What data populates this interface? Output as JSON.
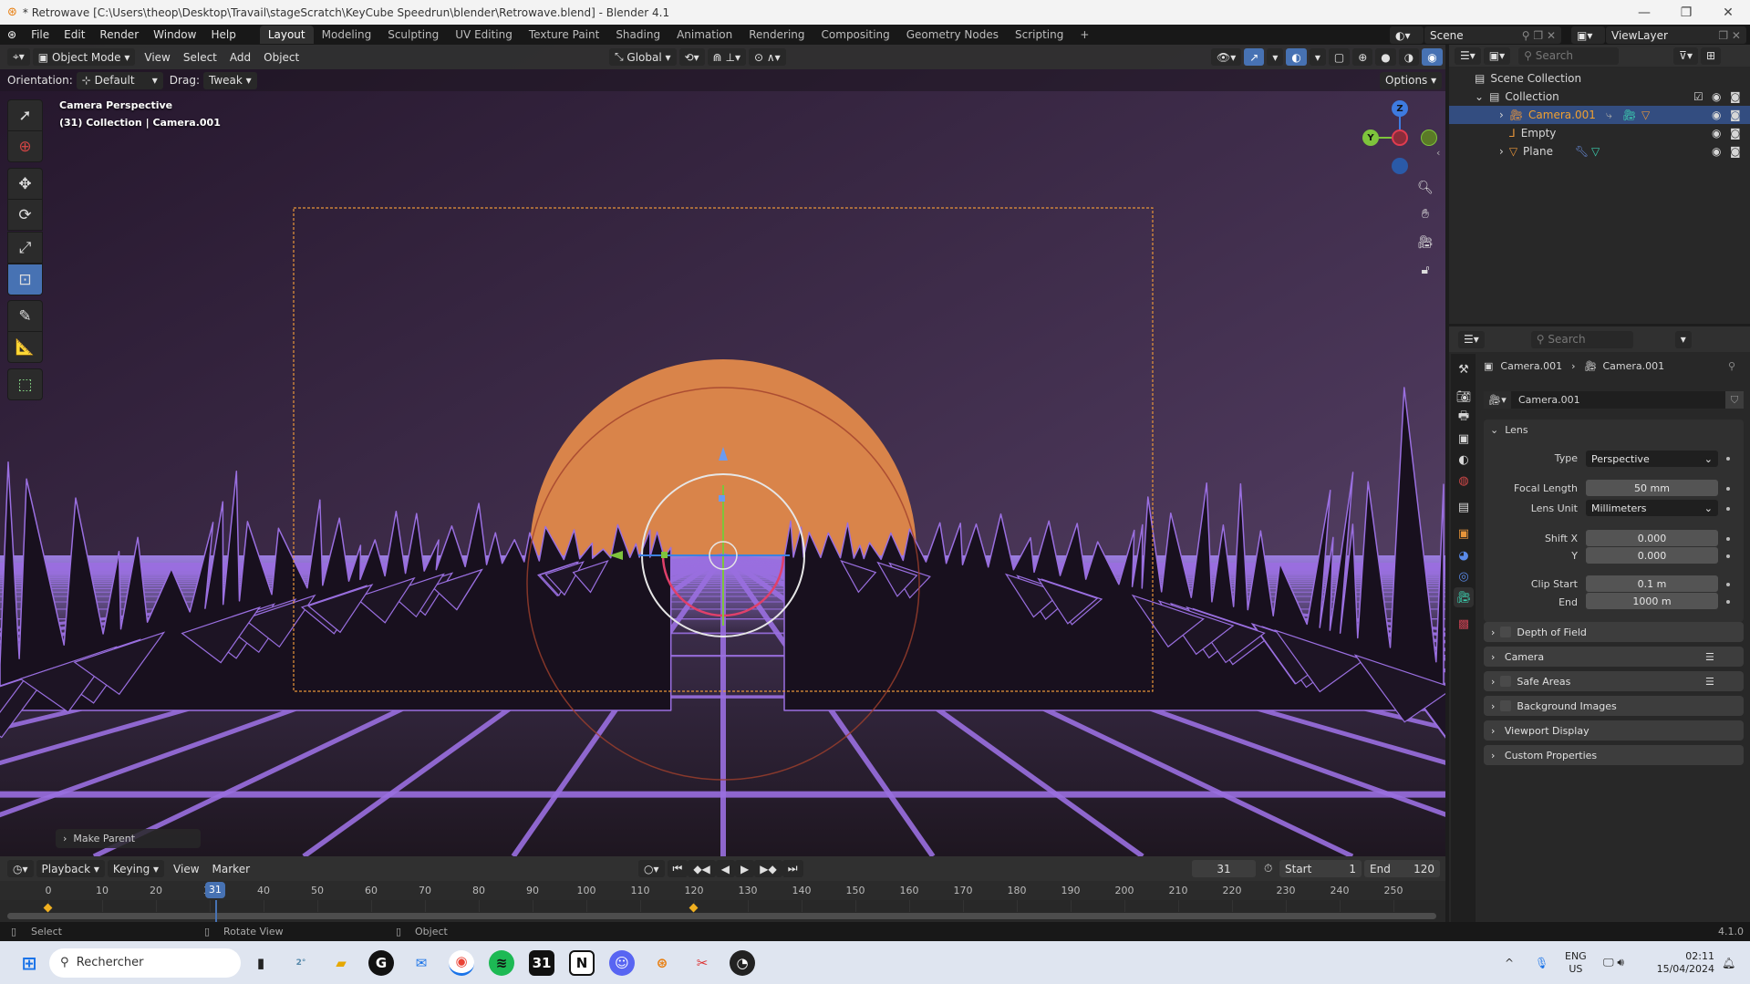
{
  "window": {
    "title": "* Retrowave [C:\\Users\\theop\\Desktop\\Travail\\stageScratch\\KeyCube Speedrun\\blender\\Retrowave.blend] - Blender 4.1"
  },
  "menu": {
    "items": [
      "File",
      "Edit",
      "Render",
      "Window",
      "Help"
    ],
    "workspaces": [
      "Layout",
      "Modeling",
      "Sculpting",
      "UV Editing",
      "Texture Paint",
      "Shading",
      "Animation",
      "Rendering",
      "Compositing",
      "Geometry Nodes",
      "Scripting"
    ],
    "active_workspace": "Layout",
    "add_tab": "+",
    "scene": "Scene",
    "view_layer": "ViewLayer"
  },
  "viewport": {
    "mode": "Object Mode",
    "menus": [
      "View",
      "Select",
      "Add",
      "Object"
    ],
    "transform_orientation": "Global",
    "orientation_label": "Orientation:",
    "orientation_value": "Default",
    "drag_label": "Drag:",
    "drag_value": "Tweak",
    "options": "Options",
    "overlay_line1": "Camera Perspective",
    "overlay_line2": "(31) Collection | Camera.001",
    "last_operator": "Make Parent",
    "gizmo": {
      "z": "Z",
      "y": "Y"
    },
    "colors": {
      "sun": "#d9844a",
      "grid": "#9a6fe0",
      "sky_top": "#2a1a30",
      "camera_frame": "#e8953a",
      "active_tool": "#4772b3"
    }
  },
  "outliner": {
    "search_placeholder": "Search",
    "rows": [
      {
        "label": "Scene Collection"
      },
      {
        "label": "Collection"
      },
      {
        "label": "Camera.001",
        "selected": true
      },
      {
        "label": "Empty"
      },
      {
        "label": "Plane"
      }
    ]
  },
  "properties": {
    "search_placeholder": "Search",
    "breadcrumb": [
      "Camera.001",
      "Camera.001"
    ],
    "datablock": "Camera.001",
    "lens": {
      "title": "Lens",
      "type_label": "Type",
      "type": "Perspective",
      "focal_label": "Focal Length",
      "focal": "50 mm",
      "unit_label": "Lens Unit",
      "unit": "Millimeters",
      "shiftx_label": "Shift X",
      "shiftx": "0.000",
      "shifty_label": "Y",
      "shifty": "0.000",
      "clipstart_label": "Clip Start",
      "clipstart": "0.1 m",
      "clipend_label": "End",
      "clipend": "1000 m"
    },
    "panels": [
      "Depth of Field",
      "Camera",
      "Safe Areas",
      "Background Images",
      "Viewport Display",
      "Custom Properties"
    ]
  },
  "timeline": {
    "menus": [
      "Playback",
      "Keying",
      "View",
      "Marker"
    ],
    "current_frame": "31",
    "start_label": "Start",
    "start": "1",
    "end_label": "End",
    "end": "120",
    "ticks": [
      "0",
      "10",
      "20",
      "30",
      "40",
      "50",
      "60",
      "70",
      "80",
      "90",
      "100",
      "110",
      "120",
      "130",
      "140",
      "150",
      "160",
      "170",
      "180",
      "190",
      "200",
      "210",
      "220",
      "230",
      "240",
      "250"
    ],
    "keyframes": [
      0,
      120
    ]
  },
  "statusbar": {
    "select": "Select",
    "rotate": "Rotate View",
    "object": "Object",
    "version": "4.1.0"
  },
  "taskbar": {
    "search": "Rechercher",
    "lang1": "ENG",
    "lang2": "US",
    "time": "02:11",
    "date": "15/04/2024",
    "weather_badge": "2°"
  }
}
